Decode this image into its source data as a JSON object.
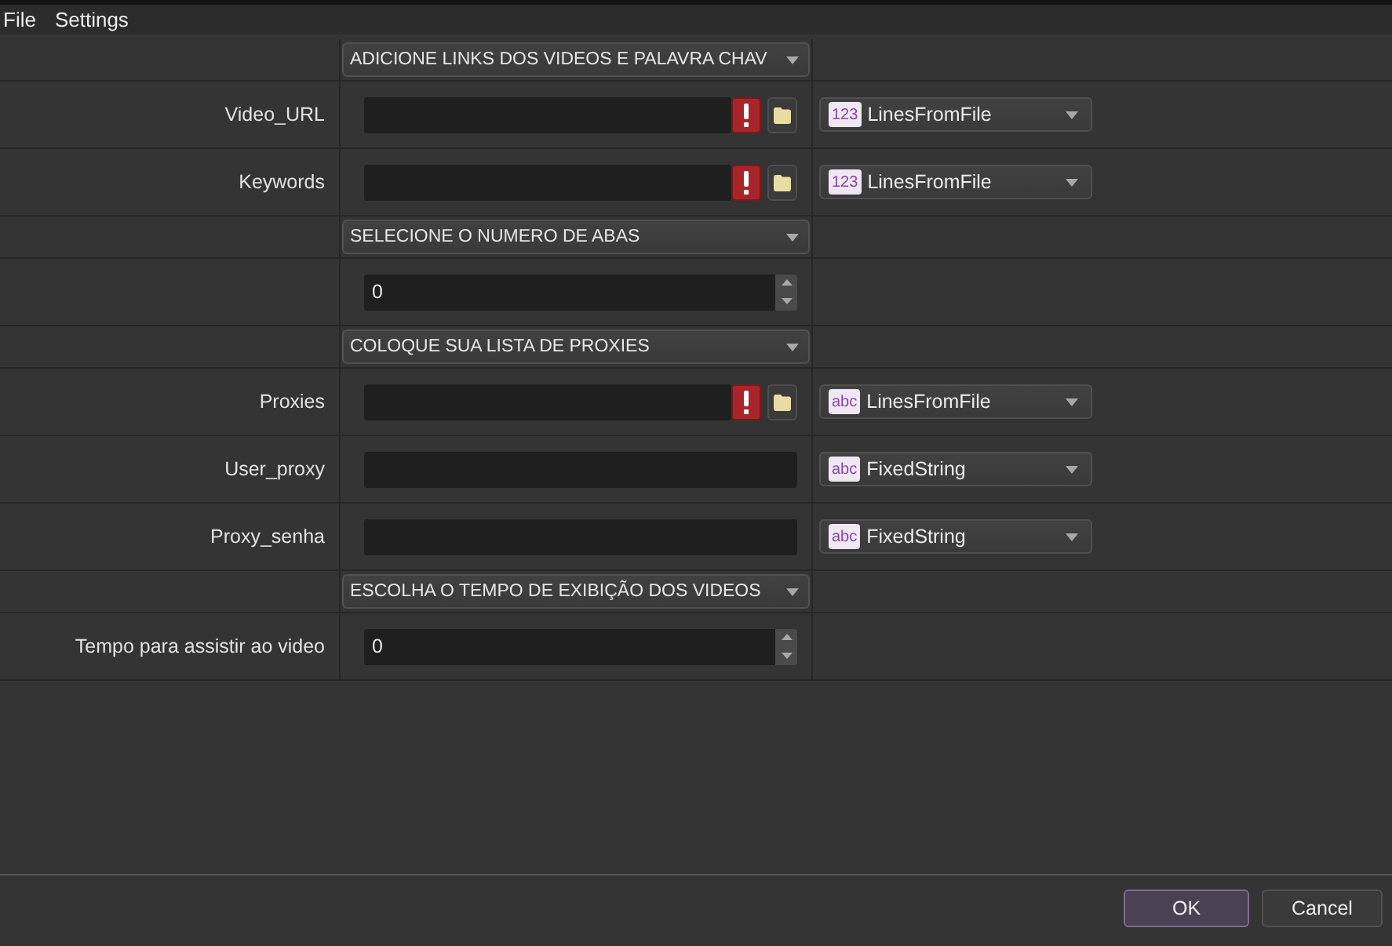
{
  "menu": [
    {
      "label": "File"
    },
    {
      "label": "Settings"
    }
  ],
  "rows": [
    {
      "kind": "section",
      "title": "ADICIONE LINKS DOS VIDEOS E PALAVRA CHAV"
    },
    {
      "kind": "file",
      "label": "Video_URL",
      "error": true,
      "source": {
        "badge": "123",
        "value": "LinesFromFile"
      }
    },
    {
      "kind": "file",
      "label": "Keywords",
      "error": true,
      "source": {
        "badge": "123",
        "value": "LinesFromFile"
      }
    },
    {
      "kind": "section",
      "title": "SELECIONE O NUMERO DE ABAS"
    },
    {
      "kind": "number",
      "value": "0"
    },
    {
      "kind": "section",
      "title": "COLOQUE SUA LISTA DE PROXIES"
    },
    {
      "kind": "file",
      "label": "Proxies",
      "error": true,
      "source": {
        "badge": "abc",
        "value": "LinesFromFile"
      }
    },
    {
      "kind": "text",
      "label": "User_proxy",
      "source": {
        "badge": "abc",
        "value": "FixedString"
      }
    },
    {
      "kind": "text",
      "label": "Proxy_senha",
      "source": {
        "badge": "abc",
        "value": "FixedString"
      }
    },
    {
      "kind": "section",
      "title": "ESCOLHA O TEMPO DE EXIBIÇÃO DOS VIDEOS"
    },
    {
      "kind": "number",
      "label": "Tempo para assistir ao video",
      "value": "0"
    }
  ],
  "buttons": [
    {
      "label": "OK",
      "default": true
    },
    {
      "label": "Cancel",
      "default": false
    }
  ]
}
